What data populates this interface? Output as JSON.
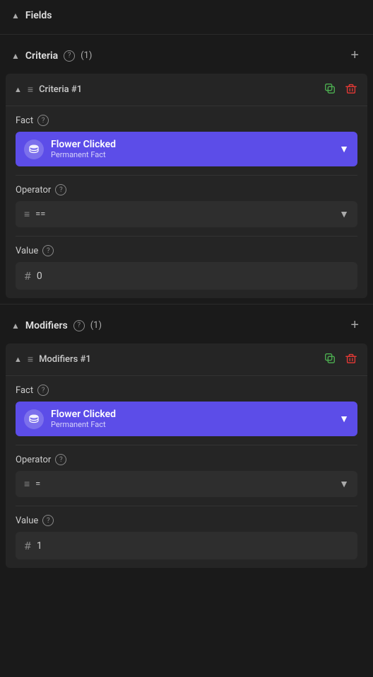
{
  "page": {
    "fields_label": "Fields",
    "criteria_section": {
      "label": "Criteria",
      "count": "(1)",
      "add_label": "+",
      "item": {
        "label": "Criteria #1",
        "fact_label": "Fact",
        "fact_name": "Flower Clicked",
        "fact_sub": "Permanent Fact",
        "operator_label": "Operator",
        "operator_value": "==",
        "value_label": "Value",
        "value": "0"
      }
    },
    "modifiers_section": {
      "label": "Modifiers",
      "count": "(1)",
      "add_label": "+",
      "item": {
        "label": "Modifiers #1",
        "fact_label": "Fact",
        "fact_name": "Flower Clicked",
        "fact_sub": "Permanent Fact",
        "operator_label": "Operator",
        "operator_value": "=",
        "value_label": "Value",
        "value": "1"
      }
    }
  },
  "icons": {
    "chevron_up": "▲",
    "chevron_down": "▼",
    "chevron_right": "▸",
    "drag": "≡",
    "hash": "#",
    "db": "🗄"
  }
}
